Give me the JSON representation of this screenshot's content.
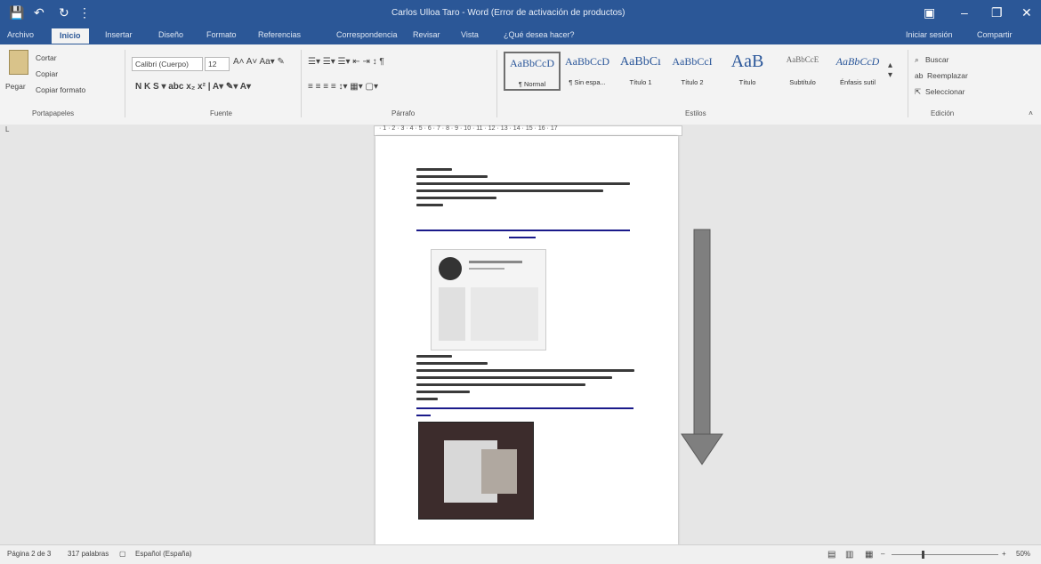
{
  "window": {
    "title": "Carlos Ulloa Taro - Word (Error de activación de productos)",
    "sign_in": "Iniciar sesión",
    "share": "Compartir"
  },
  "tabs": [
    "Archivo",
    "Inicio",
    "Insertar",
    "Diseño",
    "Formato",
    "Referencias",
    "Correspondencia",
    "Revisar",
    "Vista",
    "¿Qué desea hacer?"
  ],
  "ribbon": {
    "clipboard": {
      "paste": "Pegar",
      "cut": "Cortar",
      "copy": "Copiar",
      "format_painter": "Copiar formato",
      "group": "Portapapeles"
    },
    "font": {
      "name": "Calibri (Cuerpo)",
      "size": "12",
      "group": "Fuente"
    },
    "paragraph": {
      "group": "Párrafo"
    },
    "styles": {
      "items": [
        {
          "preview": "AaBbCcD",
          "label": "¶ Normal"
        },
        {
          "preview": "AaBbCcD",
          "label": "¶ Sin espa..."
        },
        {
          "preview": "AaBbCı",
          "label": "Título 1"
        },
        {
          "preview": "AaBbCcI",
          "label": "Título 2"
        },
        {
          "preview": "AaB",
          "label": "Título"
        },
        {
          "preview": "AaBbCcE",
          "label": "Subtítulo"
        },
        {
          "preview": "AaBbCcD",
          "label": "Énfasis sutil"
        }
      ],
      "group": "Estilos"
    },
    "editing": {
      "find": "Buscar",
      "replace": "Reemplazar",
      "select": "Seleccionar",
      "group": "Edición"
    }
  },
  "status": {
    "page": "Página 2 de 3",
    "words": "317 palabras",
    "language": "Español (España)",
    "zoom": "50%"
  },
  "colors": {
    "accent": "#2b5797",
    "arrow": "#7f7f7f"
  }
}
